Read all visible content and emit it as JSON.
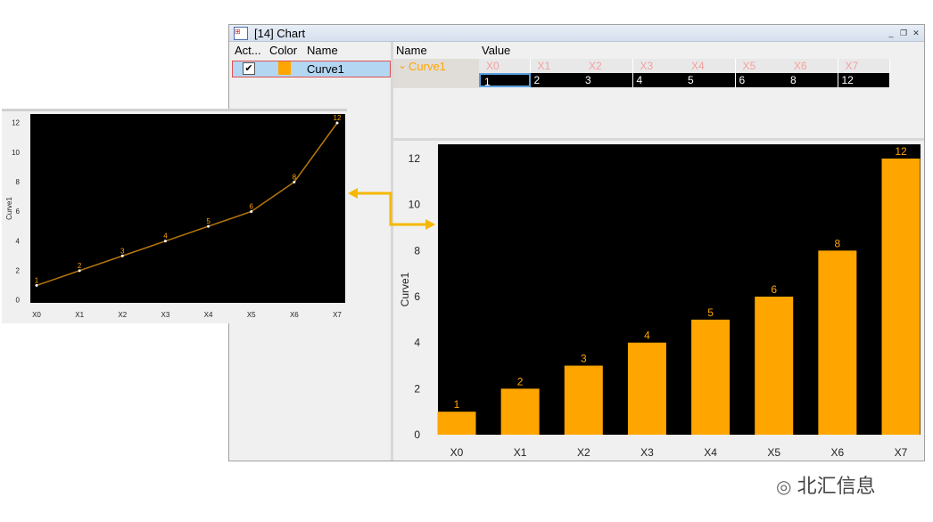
{
  "window": {
    "title": "[14] Chart"
  },
  "left_panel": {
    "headers": [
      "Act...",
      "Color",
      "Name"
    ],
    "rows": [
      {
        "active": true,
        "color": "#FFA500",
        "name": "Curve1"
      }
    ]
  },
  "value_table": {
    "headers": [
      "Name",
      "Value"
    ],
    "curve_name": "Curve1",
    "columns": [
      "X0",
      "X1",
      "X2",
      "X3",
      "X4",
      "X5",
      "X6",
      "X7"
    ],
    "values": [
      "1",
      "2",
      "3",
      "4",
      "5",
      "6",
      "8",
      "12"
    ]
  },
  "watermark": "北汇信息",
  "chart_data": [
    {
      "type": "bar",
      "categories": [
        "X0",
        "X1",
        "X2",
        "X3",
        "X4",
        "X5",
        "X6",
        "X7"
      ],
      "values": [
        1,
        2,
        3,
        4,
        5,
        6,
        8,
        12
      ],
      "ylabel": "Curve1",
      "ylim": [
        0,
        12
      ],
      "yticks": [
        0,
        2,
        4,
        6,
        8,
        10,
        12
      ],
      "color": "#FFA500",
      "background": "#000000",
      "data_labels": true
    },
    {
      "type": "line",
      "categories": [
        "X0",
        "X1",
        "X2",
        "X3",
        "X4",
        "X5",
        "X6",
        "X7"
      ],
      "values": [
        1,
        2,
        3,
        4,
        5,
        6,
        8,
        12
      ],
      "ylabel": "Curve1",
      "ylim": [
        0,
        12
      ],
      "yticks": [
        0,
        2,
        4,
        6,
        8,
        10,
        12
      ],
      "color": "#B8780A",
      "background": "#000000",
      "data_labels": true
    }
  ]
}
